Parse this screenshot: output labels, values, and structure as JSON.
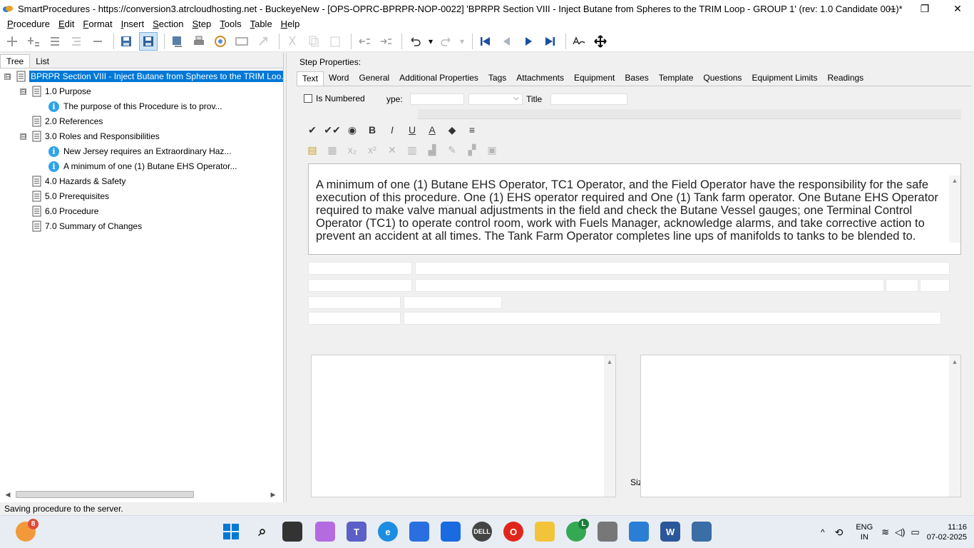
{
  "window": {
    "title": "SmartProcedures - https://conversion3.atrcloudhosting.net - BuckeyeNew - [OPS-OPRC-BPRPR-NOP-0022] 'BPRPR Section VIII - Inject Butane from Spheres to the TRIM Loop - GROUP 1' (rev: 1.0 Candidate 001)*",
    "minimize": "─",
    "maximize": "❐",
    "close": "✕"
  },
  "menu": [
    "Procedure",
    "Edit",
    "Format",
    "Insert",
    "Section",
    "Step",
    "Tools",
    "Table",
    "Help"
  ],
  "left_tabs": [
    "Tree",
    "List"
  ],
  "tree": [
    {
      "label": "BPRPR Section VIII - Inject Butane from Spheres to the TRIM Loo...",
      "expander": "⊟"
    },
    {
      "label": "1.0 Purpose",
      "expander": "⊟"
    },
    {
      "label": "The purpose of this Procedure is to prov...",
      "info": "i"
    },
    {
      "label": "2.0 References"
    },
    {
      "label": "3.0 Roles and Responsibilities",
      "expander": "⊟"
    },
    {
      "label": "New Jersey requires an Extraordinary Haz...",
      "info": "i"
    },
    {
      "label": "A minimum of one (1) Butane EHS Operator...",
      "info": "i"
    },
    {
      "label": "4.0 Hazards & Safety"
    },
    {
      "label": "5.0 Prerequisites"
    },
    {
      "label": "6.0 Procedure"
    },
    {
      "label": "7.0 Summary of Changes"
    }
  ],
  "step_properties": {
    "label": "Step Properties:",
    "tabs": [
      "Text",
      "Word",
      "General",
      "Additional Properties",
      "Tags",
      "Attachments",
      "Equipment",
      "Bases",
      "Template",
      "Questions",
      "Equipment Limits",
      "Readings"
    ],
    "is_numbered_label": "Is Numbered",
    "type_label": "ype:",
    "title_label": "Title",
    "editor_buttons": [
      "✔",
      "✔✔",
      "◉",
      "B",
      "I",
      "U",
      "A",
      "◆",
      "≡"
    ],
    "text_content": "A minimum of one (1) Butane EHS Operator, TC1 Operator, and the Field Operator have the responsibility for the safe execution of this procedure. One (1) EHS operator required and One (1) Tank farm operator. One Butane EHS Operator required to make valve manual adjustments in the field and check the Butane Vessel gauges; one Terminal Control Operator (TC1) to operate control room, work with Fuels Manager, acknowledge alarms, and take corrective action to prevent an accident at all times. The Tank Farm Operator completes line ups of manifolds to tanks to be blended to.",
    "size_label": "Siz"
  },
  "status": "Saving procedure to the server.",
  "taskbar": {
    "badge_count": "8",
    "chrome_badge": "L",
    "language": "ENG",
    "region": "IN",
    "time": "11:16",
    "date": "07-02-2025"
  }
}
